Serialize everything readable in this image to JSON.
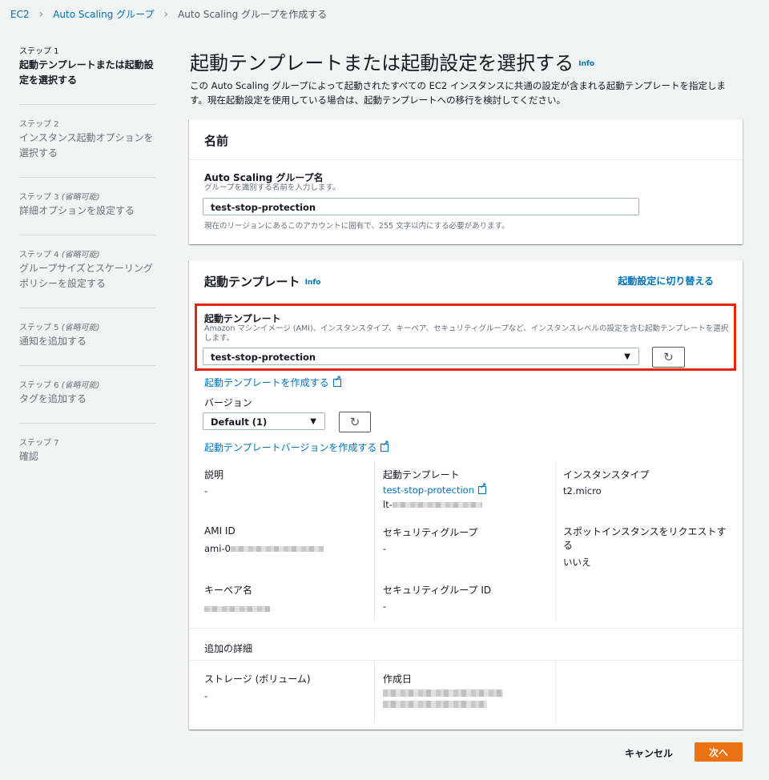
{
  "breadcrumb": {
    "items": [
      "EC2",
      "Auto Scaling グループ",
      "Auto Scaling グループを作成する"
    ]
  },
  "steps": [
    {
      "num": "ステップ 1",
      "optional": "",
      "title": "起動テンプレートまたは起動設定を選択する",
      "active": true
    },
    {
      "num": "ステップ 2",
      "optional": "",
      "title": "インスタンス起動オプションを選択する",
      "active": false
    },
    {
      "num": "ステップ 3",
      "optional": "(省略可能)",
      "title": "詳細オプションを設定する",
      "active": false
    },
    {
      "num": "ステップ 4",
      "optional": "(省略可能)",
      "title": "グループサイズとスケーリングポリシーを設定する",
      "active": false
    },
    {
      "num": "ステップ 5",
      "optional": "(省略可能)",
      "title": "通知を追加する",
      "active": false
    },
    {
      "num": "ステップ 6",
      "optional": "(省略可能)",
      "title": "タグを追加する",
      "active": false
    },
    {
      "num": "ステップ 7",
      "optional": "",
      "title": "確認",
      "active": false
    }
  ],
  "page": {
    "title": "起動テンプレートまたは起動設定を選択する",
    "info": "Info",
    "description": "この Auto Scaling グループによって起動されたすべての EC2 インスタンスに共通の設定が含まれる起動テンプレートを指定します。現在起動設定を使用している場合は、起動テンプレートへの移行を検討してください。"
  },
  "name_panel": {
    "header": "名前",
    "field_label": "Auto Scaling グループ名",
    "field_desc": "グループを識別する名前を入力します。",
    "field_value": "test-stop-protection",
    "constraint": "現在のリージョンにあるこのアカウントに固有で、255 文字以内にする必要があります。"
  },
  "template_panel": {
    "header": "起動テンプレート",
    "info": "Info",
    "switch_link": "起動設定に切り替える",
    "field_label": "起動テンプレート",
    "field_desc": "Amazon マシンイメージ (AMI)、インスタンスタイプ、キーペア、セキュリティグループなど、インスタンスレベルの設定を含む起動テンプレートを選択します。",
    "selected": "test-stop-protection",
    "create_link": "起動テンプレートを作成する",
    "version_label": "バージョン",
    "version_selected": "Default (1)",
    "create_version_link": "起動テンプレートバージョンを作成する",
    "details": {
      "description_label": "説明",
      "description_value": "-",
      "template_label": "起動テンプレート",
      "template_value": "test-stop-protection",
      "template_id_prefix": "lt-",
      "instance_type_label": "インスタンスタイプ",
      "instance_type_value": "t2.micro",
      "ami_label": "AMI ID",
      "ami_prefix": "ami-0",
      "security_group_label": "セキュリティグループ",
      "security_group_value": "-",
      "spot_label": "スポットインスタンスをリクエストする",
      "spot_value": "いいえ",
      "keypair_label": "キーペア名",
      "sg_id_label": "セキュリティグループ ID",
      "sg_id_value": "-"
    },
    "additional": {
      "header": "追加の詳細",
      "storage_label": "ストレージ (ボリューム)",
      "storage_value": "-",
      "created_label": "作成日"
    }
  },
  "footer": {
    "cancel": "キャンセル",
    "next": "次へ"
  },
  "colors": {
    "accent_link": "#0073bb",
    "primary_button": "#ec7211",
    "highlight_box": "#e8230c"
  }
}
